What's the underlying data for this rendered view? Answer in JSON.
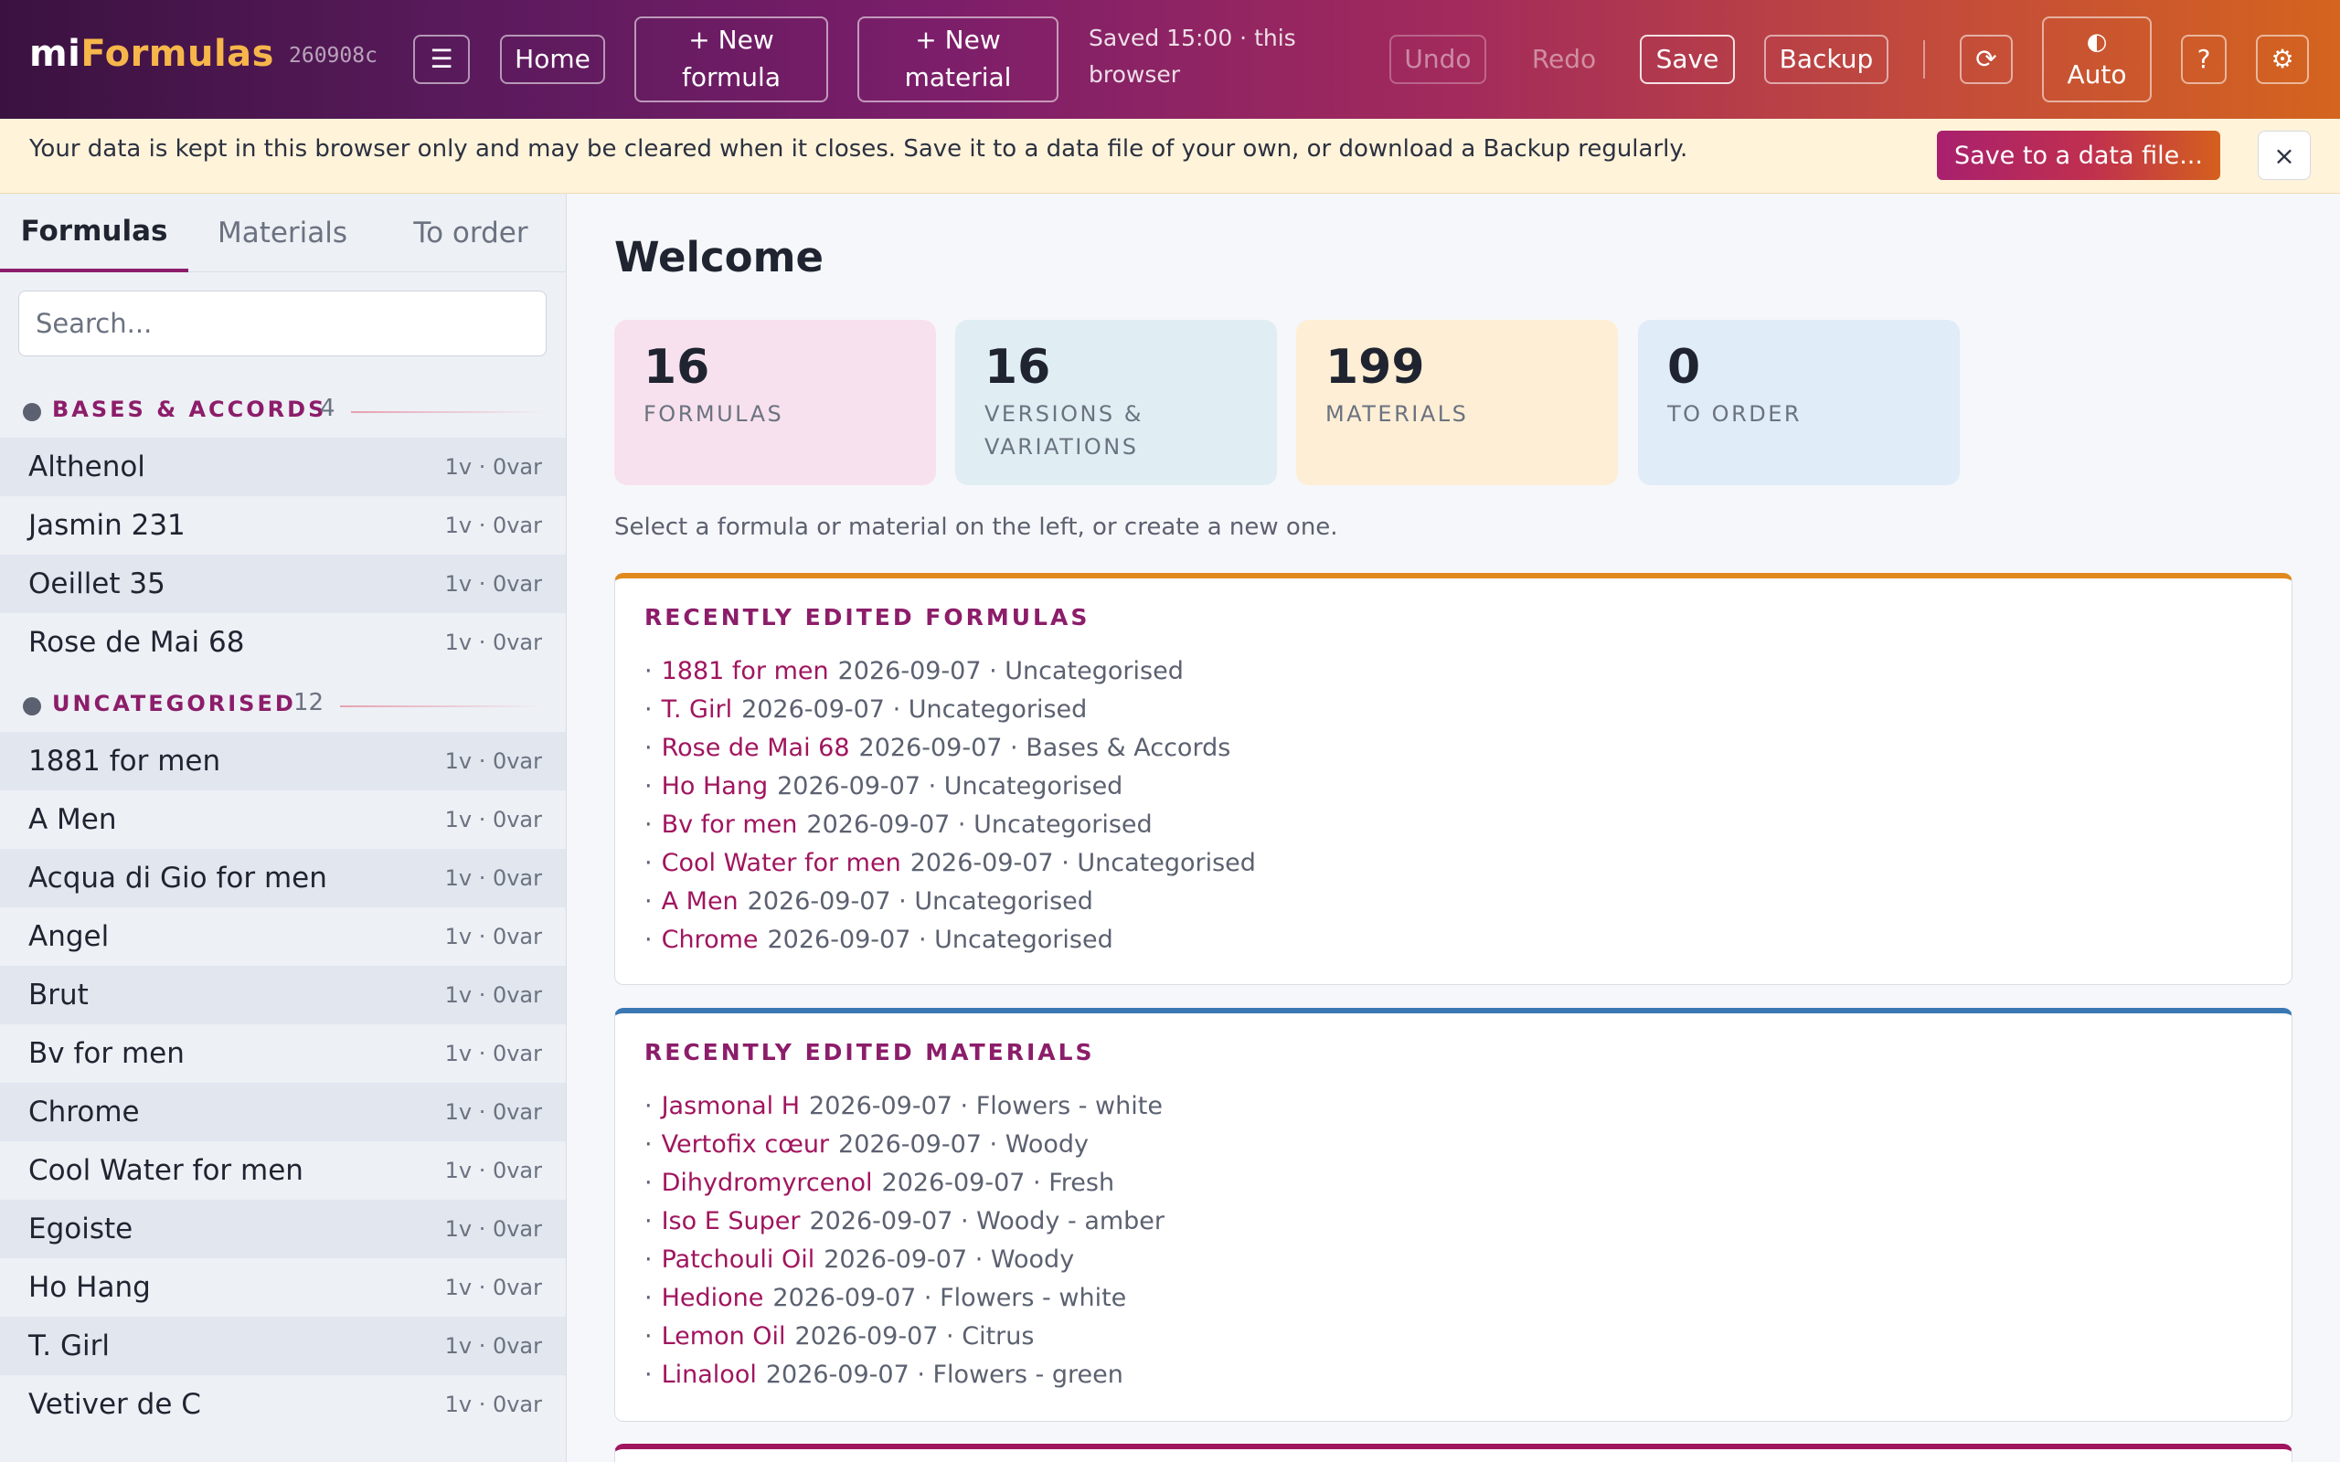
{
  "app": {
    "brand_prefix": "mi",
    "brand_suffix": "Formulas",
    "build": "260908c"
  },
  "toolbar": {
    "menu_icon": "☰",
    "home": "Home",
    "new_formula": "+ New formula",
    "new_material": "+ New material",
    "saved_status": "Saved 15:00 · this browser",
    "undo": "Undo",
    "redo": "Redo",
    "save": "Save",
    "backup": "Backup",
    "refresh_icon": "⟳",
    "theme_icon": "◐",
    "theme": "Auto",
    "help": "?",
    "settings_icon": "⚙"
  },
  "banner": {
    "text": "Your data is kept in this browser only and may be cleared when it closes. Save it to a data file of your own, or download a Backup regularly.",
    "button": "Save to a data file...",
    "close": "×"
  },
  "sidebar": {
    "tabs": [
      "Formulas",
      "Materials",
      "To order"
    ],
    "active_tab": "Formulas",
    "search_placeholder": "Search...",
    "groups": [
      {
        "name": "BASES & ACCORDS",
        "count": "4",
        "items": [
          {
            "name": "Althenol",
            "meta": "1v · 0var"
          },
          {
            "name": "Jasmin 231",
            "meta": "1v · 0var"
          },
          {
            "name": "Oeillet 35",
            "meta": "1v · 0var"
          },
          {
            "name": "Rose de Mai 68",
            "meta": "1v · 0var"
          }
        ]
      },
      {
        "name": "UNCATEGORISED",
        "count": "12",
        "items": [
          {
            "name": "1881 for men",
            "meta": "1v · 0var"
          },
          {
            "name": "A Men",
            "meta": "1v · 0var"
          },
          {
            "name": "Acqua di Gio for men",
            "meta": "1v · 0var"
          },
          {
            "name": "Angel",
            "meta": "1v · 0var"
          },
          {
            "name": "Brut",
            "meta": "1v · 0var"
          },
          {
            "name": "Bv for men",
            "meta": "1v · 0var"
          },
          {
            "name": "Chrome",
            "meta": "1v · 0var"
          },
          {
            "name": "Cool Water for men",
            "meta": "1v · 0var"
          },
          {
            "name": "Egoiste",
            "meta": "1v · 0var"
          },
          {
            "name": "Ho Hang",
            "meta": "1v · 0var"
          },
          {
            "name": "T. Girl",
            "meta": "1v · 0var"
          },
          {
            "name": "Vetiver de C",
            "meta": "1v · 0var"
          }
        ]
      }
    ]
  },
  "main": {
    "title": "Welcome",
    "stats": [
      {
        "value": "16",
        "label": "FORMULAS",
        "color": "#f8e1ee"
      },
      {
        "value": "16",
        "label": "VERSIONS & VARIATIONS",
        "color": "#e0eef3"
      },
      {
        "value": "199",
        "label": "MATERIALS",
        "color": "#fdeed5"
      },
      {
        "value": "0",
        "label": "TO ORDER",
        "color": "#e0ecf8"
      }
    ],
    "hint": "Select a formula or material on the left, or create a new one.",
    "recent_formulas": {
      "title": "RECENTLY EDITED FORMULAS",
      "accent": "#e08a1e",
      "items": [
        {
          "name": "1881 for men",
          "date": "2026-09-07",
          "category": "Uncategorised"
        },
        {
          "name": "T. Girl",
          "date": "2026-09-07",
          "category": "Uncategorised"
        },
        {
          "name": "Rose de Mai 68",
          "date": "2026-09-07",
          "category": "Bases & Accords"
        },
        {
          "name": "Ho Hang",
          "date": "2026-09-07",
          "category": "Uncategorised"
        },
        {
          "name": "Bv for men",
          "date": "2026-09-07",
          "category": "Uncategorised"
        },
        {
          "name": "Cool Water for men",
          "date": "2026-09-07",
          "category": "Uncategorised"
        },
        {
          "name": "A Men",
          "date": "2026-09-07",
          "category": "Uncategorised"
        },
        {
          "name": "Chrome",
          "date": "2026-09-07",
          "category": "Uncategorised"
        }
      ]
    },
    "recent_materials": {
      "title": "RECENTLY EDITED MATERIALS",
      "accent": "#3a78b4",
      "items": [
        {
          "name": "Jasmonal H",
          "date": "2026-09-07",
          "category": "Flowers - white"
        },
        {
          "name": "Vertofix cœur",
          "date": "2026-09-07",
          "category": "Woody"
        },
        {
          "name": "Dihydromyrcenol",
          "date": "2026-09-07",
          "category": "Fresh"
        },
        {
          "name": "Iso E Super",
          "date": "2026-09-07",
          "category": "Woody - amber"
        },
        {
          "name": "Patchouli Oil",
          "date": "2026-09-07",
          "category": "Woody"
        },
        {
          "name": "Hedione",
          "date": "2026-09-07",
          "category": "Flowers - white"
        },
        {
          "name": "Lemon Oil",
          "date": "2026-09-07",
          "category": "Citrus"
        },
        {
          "name": "Linalool",
          "date": "2026-09-07",
          "category": "Flowers - green"
        }
      ]
    },
    "third_card_accent": "#a0155e"
  }
}
